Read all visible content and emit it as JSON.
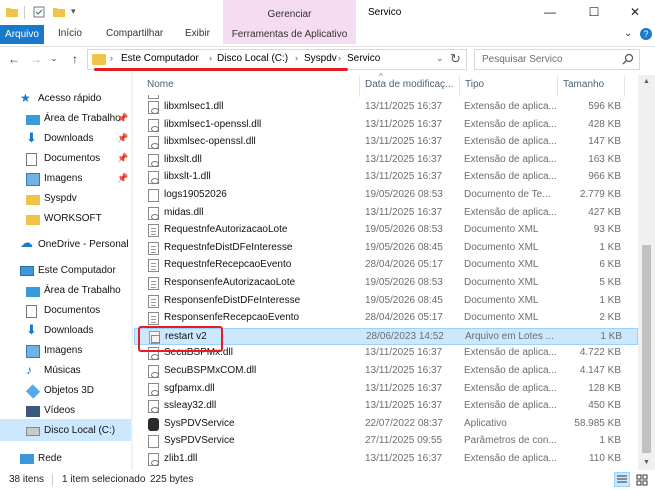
{
  "window": {
    "title": "Servico",
    "context_group": "Gerenciar",
    "minimize": "—",
    "maximize": "☐",
    "close": "✕"
  },
  "ribbon": {
    "tabs": [
      "Arquivo",
      "Início",
      "Compartilhar",
      "Exibir",
      "Ferramentas de Aplicativo"
    ],
    "collapse": "⌄",
    "help": "?"
  },
  "address": {
    "crumbs": [
      "Este Computador",
      "Disco Local (C:)",
      "Syspdv",
      "Servico"
    ],
    "search_placeholder": "Pesquisar Servico"
  },
  "nav_pane": {
    "quick_access": "Acesso rápido",
    "quick_items": [
      "Área de Trabalho",
      "Downloads",
      "Documentos",
      "Imagens",
      "Syspdv",
      "WORKSOFT"
    ],
    "onedrive": "OneDrive - Personal",
    "this_pc": "Este Computador",
    "pc_items": [
      "Área de Trabalho",
      "Documentos",
      "Downloads",
      "Imagens",
      "Músicas",
      "Objetos 3D",
      "Vídeos",
      "Disco Local (C:)"
    ],
    "network": "Rede"
  },
  "columns": {
    "name": "Nome",
    "date": "Data de modificaç...",
    "type": "Tipo",
    "size": "Tamanho"
  },
  "files": [
    {
      "name": "libxmlsec1.dll",
      "date": "13/11/2025 16:37",
      "type": "Extensão de aplica...",
      "size": "596 KB",
      "icon": "dll"
    },
    {
      "name": "libxmlsec1-openssl.dll",
      "date": "13/11/2025 16:37",
      "type": "Extensão de aplica...",
      "size": "428 KB",
      "icon": "dll"
    },
    {
      "name": "libxmlsec-openssl.dll",
      "date": "13/11/2025 16:37",
      "type": "Extensão de aplica...",
      "size": "147 KB",
      "icon": "dll"
    },
    {
      "name": "libxslt.dll",
      "date": "13/11/2025 16:37",
      "type": "Extensão de aplica...",
      "size": "163 KB",
      "icon": "dll"
    },
    {
      "name": "libxslt-1.dll",
      "date": "13/11/2025 16:37",
      "type": "Extensão de aplica...",
      "size": "966 KB",
      "icon": "dll"
    },
    {
      "name": "logs19052026",
      "date": "19/05/2026 08:53",
      "type": "Documento de Te...",
      "size": "2.779 KB",
      "icon": "doc"
    },
    {
      "name": "midas.dll",
      "date": "13/11/2025 16:37",
      "type": "Extensão de aplica...",
      "size": "427 KB",
      "icon": "dll"
    },
    {
      "name": "RequestnfeAutorizacaoLote",
      "date": "19/05/2026 08:53",
      "type": "Documento XML",
      "size": "93 KB",
      "icon": "xml"
    },
    {
      "name": "RequestnfeDistDFeInteresse",
      "date": "19/05/2026 08:45",
      "type": "Documento XML",
      "size": "1 KB",
      "icon": "xml"
    },
    {
      "name": "RequestnfeRecepcaoEvento",
      "date": "28/04/2026 05:17",
      "type": "Documento XML",
      "size": "6 KB",
      "icon": "xml"
    },
    {
      "name": "ResponsenfeAutorizacaoLote",
      "date": "19/05/2026 08:53",
      "type": "Documento XML",
      "size": "5 KB",
      "icon": "xml"
    },
    {
      "name": "ResponsenfeDistDFeInteresse",
      "date": "19/05/2026 08:45",
      "type": "Documento XML",
      "size": "1 KB",
      "icon": "xml"
    },
    {
      "name": "ResponsenfeRecepcaoEvento",
      "date": "28/04/2026 05:17",
      "type": "Documento XML",
      "size": "2 KB",
      "icon": "xml"
    },
    {
      "name": "restart v2",
      "date": "28/06/2023 14:52",
      "type": "Arquivo em Lotes ...",
      "size": "1 KB",
      "icon": "bat",
      "selected": true
    },
    {
      "name": "SecuBSPMx.dll",
      "date": "13/11/2025 16:37",
      "type": "Extensão de aplica...",
      "size": "4.722 KB",
      "icon": "dll"
    },
    {
      "name": "SecuBSPMxCOM.dll",
      "date": "13/11/2025 16:37",
      "type": "Extensão de aplica...",
      "size": "4.147 KB",
      "icon": "dll"
    },
    {
      "name": "sgfpamx.dll",
      "date": "13/11/2025 16:37",
      "type": "Extensão de aplica...",
      "size": "128 KB",
      "icon": "dll"
    },
    {
      "name": "ssleay32.dll",
      "date": "13/11/2025 16:37",
      "type": "Extensão de aplica...",
      "size": "450 KB",
      "icon": "dll"
    },
    {
      "name": "SysPDVService",
      "date": "22/07/2022 08:37",
      "type": "Aplicativo",
      "size": "58.985 KB",
      "icon": "exe"
    },
    {
      "name": "SysPDVService",
      "date": "27/11/2025 09:55",
      "type": "Parâmetros de con...",
      "size": "1 KB",
      "icon": "doc"
    },
    {
      "name": "zlib1.dll",
      "date": "13/11/2025 16:37",
      "type": "Extensão de aplica...",
      "size": "110 KB",
      "icon": "dll"
    }
  ],
  "status": {
    "items_count": "38 itens",
    "selection": "1 item selecionado",
    "selection_size": "225 bytes"
  },
  "colors": {
    "accent": "#1979ca",
    "selection": "#cce8ff",
    "context_tab": "#f5dcf0",
    "highlight_red": "#e51c23",
    "folder": "#f0c44a"
  }
}
